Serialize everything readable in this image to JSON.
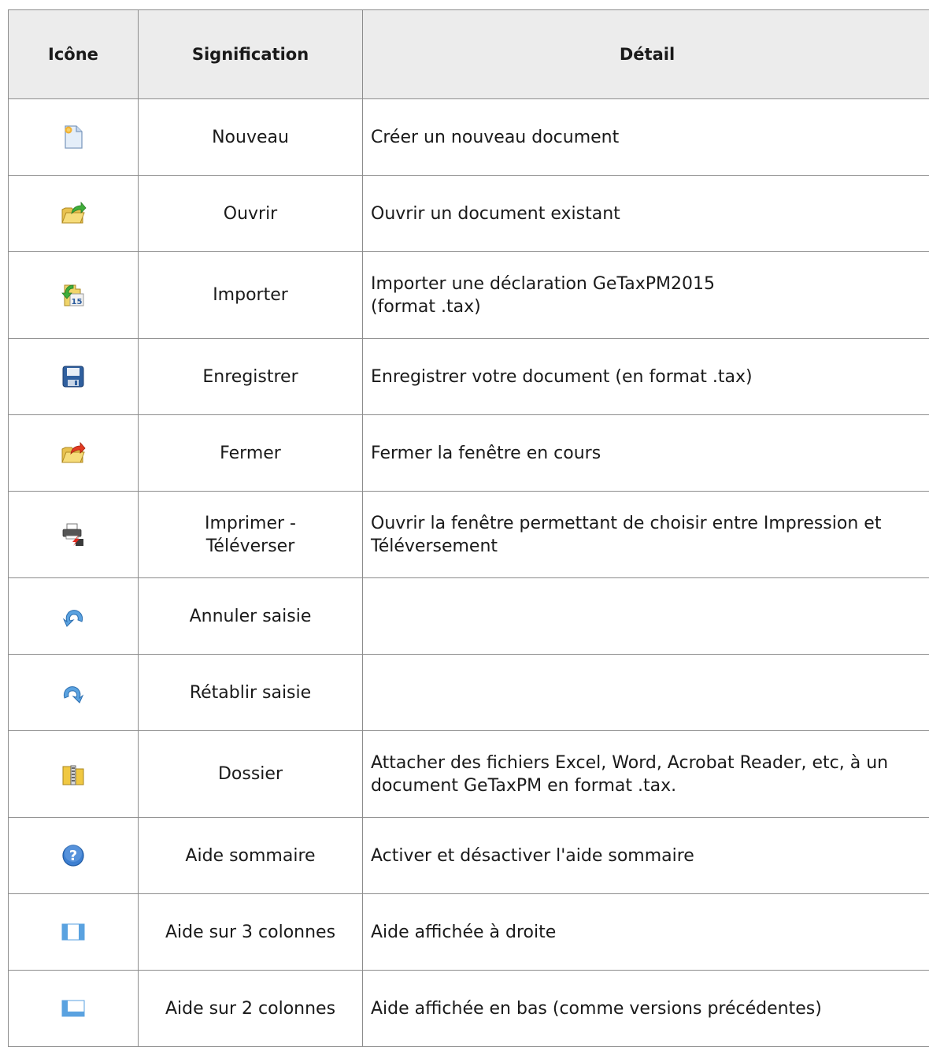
{
  "headers": {
    "icon": "Icône",
    "signification": "Signification",
    "detail": "Détail"
  },
  "rows": [
    {
      "icon": "new-document-icon",
      "signification": [
        "Nouveau"
      ],
      "detail": [
        "Créer un nouveau document"
      ]
    },
    {
      "icon": "open-folder-icon",
      "signification": [
        "Ouvrir"
      ],
      "detail": [
        "Ouvrir un document existant"
      ]
    },
    {
      "icon": "import-icon",
      "signification": [
        "Importer"
      ],
      "detail": [
        "Importer une déclaration GeTaxPM2015",
        "(format .tax)"
      ]
    },
    {
      "icon": "save-icon",
      "signification": [
        "Enregistrer"
      ],
      "detail": [
        "Enregistrer votre document (en format .tax)"
      ]
    },
    {
      "icon": "close-folder-icon",
      "signification": [
        "Fermer"
      ],
      "detail": [
        "Fermer la fenêtre en cours"
      ]
    },
    {
      "icon": "print-upload-icon",
      "signification": [
        "Imprimer -",
        "Téléverser"
      ],
      "detail": [
        "Ouvrir la fenêtre permettant de choisir entre Impression et",
        "Téléversement"
      ]
    },
    {
      "icon": "undo-icon",
      "signification": [
        "Annuler saisie"
      ],
      "detail": []
    },
    {
      "icon": "redo-icon",
      "signification": [
        "Rétablir saisie"
      ],
      "detail": []
    },
    {
      "icon": "zip-folder-icon",
      "signification": [
        "Dossier"
      ],
      "detail": [
        "Attacher des fichiers Excel, Word, Acrobat Reader, etc, à un",
        "document GeTaxPM en format .tax."
      ]
    },
    {
      "icon": "help-icon",
      "signification": [
        "Aide sommaire"
      ],
      "detail": [
        "Activer et désactiver l'aide sommaire"
      ]
    },
    {
      "icon": "three-columns-icon",
      "signification": [
        "Aide sur 3 colonnes"
      ],
      "detail": [
        "Aide affichée à droite"
      ]
    },
    {
      "icon": "two-columns-icon",
      "signification": [
        "Aide sur 2 colonnes"
      ],
      "detail": [
        "Aide affichée en bas (comme versions précédentes)"
      ]
    }
  ]
}
